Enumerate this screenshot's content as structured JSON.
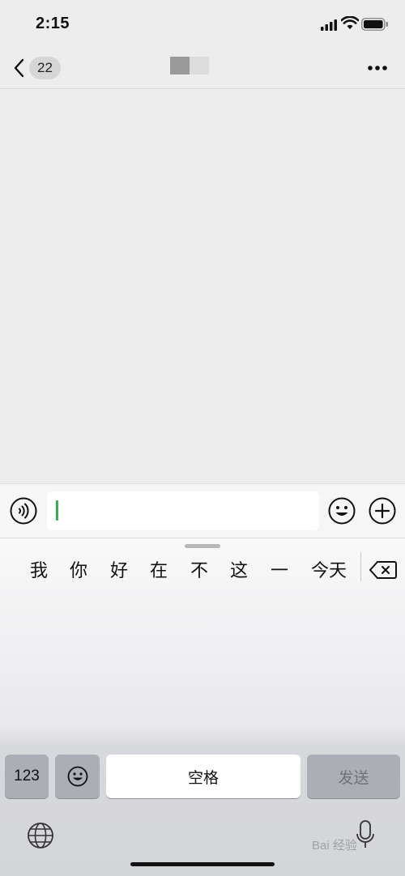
{
  "status_bar": {
    "time": "2:15"
  },
  "nav": {
    "back_icon": "chevron-left-icon",
    "unread_count": "22",
    "more_icon": "more-dots-icon"
  },
  "input_bar": {
    "voice_icon": "voice-icon",
    "text_value": "",
    "emoji_icon": "emoji-icon",
    "plus_icon": "plus-circle-icon"
  },
  "keyboard": {
    "candidates": [
      "我",
      "你",
      "好",
      "在",
      "不",
      "这",
      "一",
      "今天"
    ],
    "key_123": "123",
    "space_label": "空格",
    "send_label": "发送",
    "watermark": "Bai 经验"
  },
  "colors": {
    "cursor": "#33b04a",
    "background": "#ededed"
  }
}
